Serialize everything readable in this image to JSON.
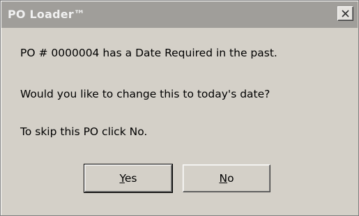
{
  "window": {
    "title": "PO Loader™"
  },
  "message": {
    "line1": "PO # 0000004 has a Date Required in the past.",
    "line2": "Would you like to change this to today's date?",
    "line3": "To skip this PO click No."
  },
  "buttons": {
    "yes": {
      "mnemonic": "Y",
      "rest": "es"
    },
    "no": {
      "mnemonic": "N",
      "rest": "o"
    }
  },
  "icons": {
    "close": "close-icon"
  },
  "colors": {
    "dialog_bg": "#d4d0c8",
    "titlebar_bg": "#a09e9a"
  }
}
